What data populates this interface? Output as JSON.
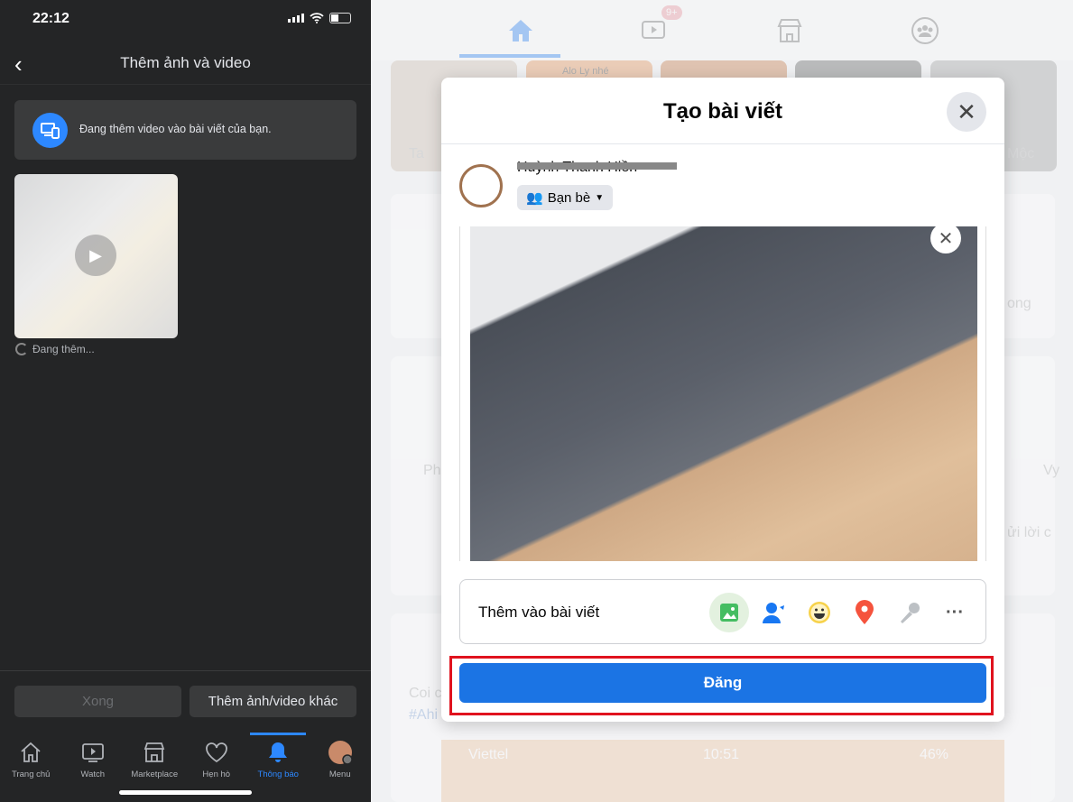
{
  "phone": {
    "status": {
      "time": "22:12"
    },
    "header": {
      "title": "Thêm ảnh và video"
    },
    "banner": {
      "text": "Đang thêm video vào bài viết của bạn."
    },
    "thumbnail": {
      "status": "Đang thêm..."
    },
    "buttons": {
      "done": "Xong",
      "add_more": "Thêm ảnh/video khác"
    },
    "tabs": [
      {
        "label": "Trang chủ",
        "icon": "home-icon"
      },
      {
        "label": "Watch",
        "icon": "watch-icon"
      },
      {
        "label": "Marketplace",
        "icon": "marketplace-icon"
      },
      {
        "label": "Hẹn hò",
        "icon": "heart-icon"
      },
      {
        "label": "Thông báo",
        "icon": "bell-icon",
        "active": true
      },
      {
        "label": "Menu",
        "icon": "avatar-icon"
      }
    ],
    "accent": "#2d88ff"
  },
  "background": {
    "watch_badge": "9+",
    "story_caption": "Alo Ly nhé",
    "fragments": [
      "Ta",
      "Mộc",
      "ong",
      "Ph",
      "Vy",
      "ửi lời c",
      "Coi c",
      "#Ahi"
    ],
    "embedded_status": {
      "carrier": "Viettel",
      "time": "10:51",
      "battery": "46%"
    }
  },
  "modal": {
    "title": "Tạo bài viết",
    "user_name": "Huỳnh Thanh Hiền",
    "audience": "Bạn bè",
    "add_to_post": "Thêm vào bài viết",
    "add_icons": [
      "photo-video-icon",
      "tag-people-icon",
      "feeling-icon",
      "location-icon",
      "microphone-icon",
      "more-icon"
    ],
    "post_button": "Đăng",
    "post_color": "#1b74e4",
    "highlight_color": "#e0121e"
  }
}
